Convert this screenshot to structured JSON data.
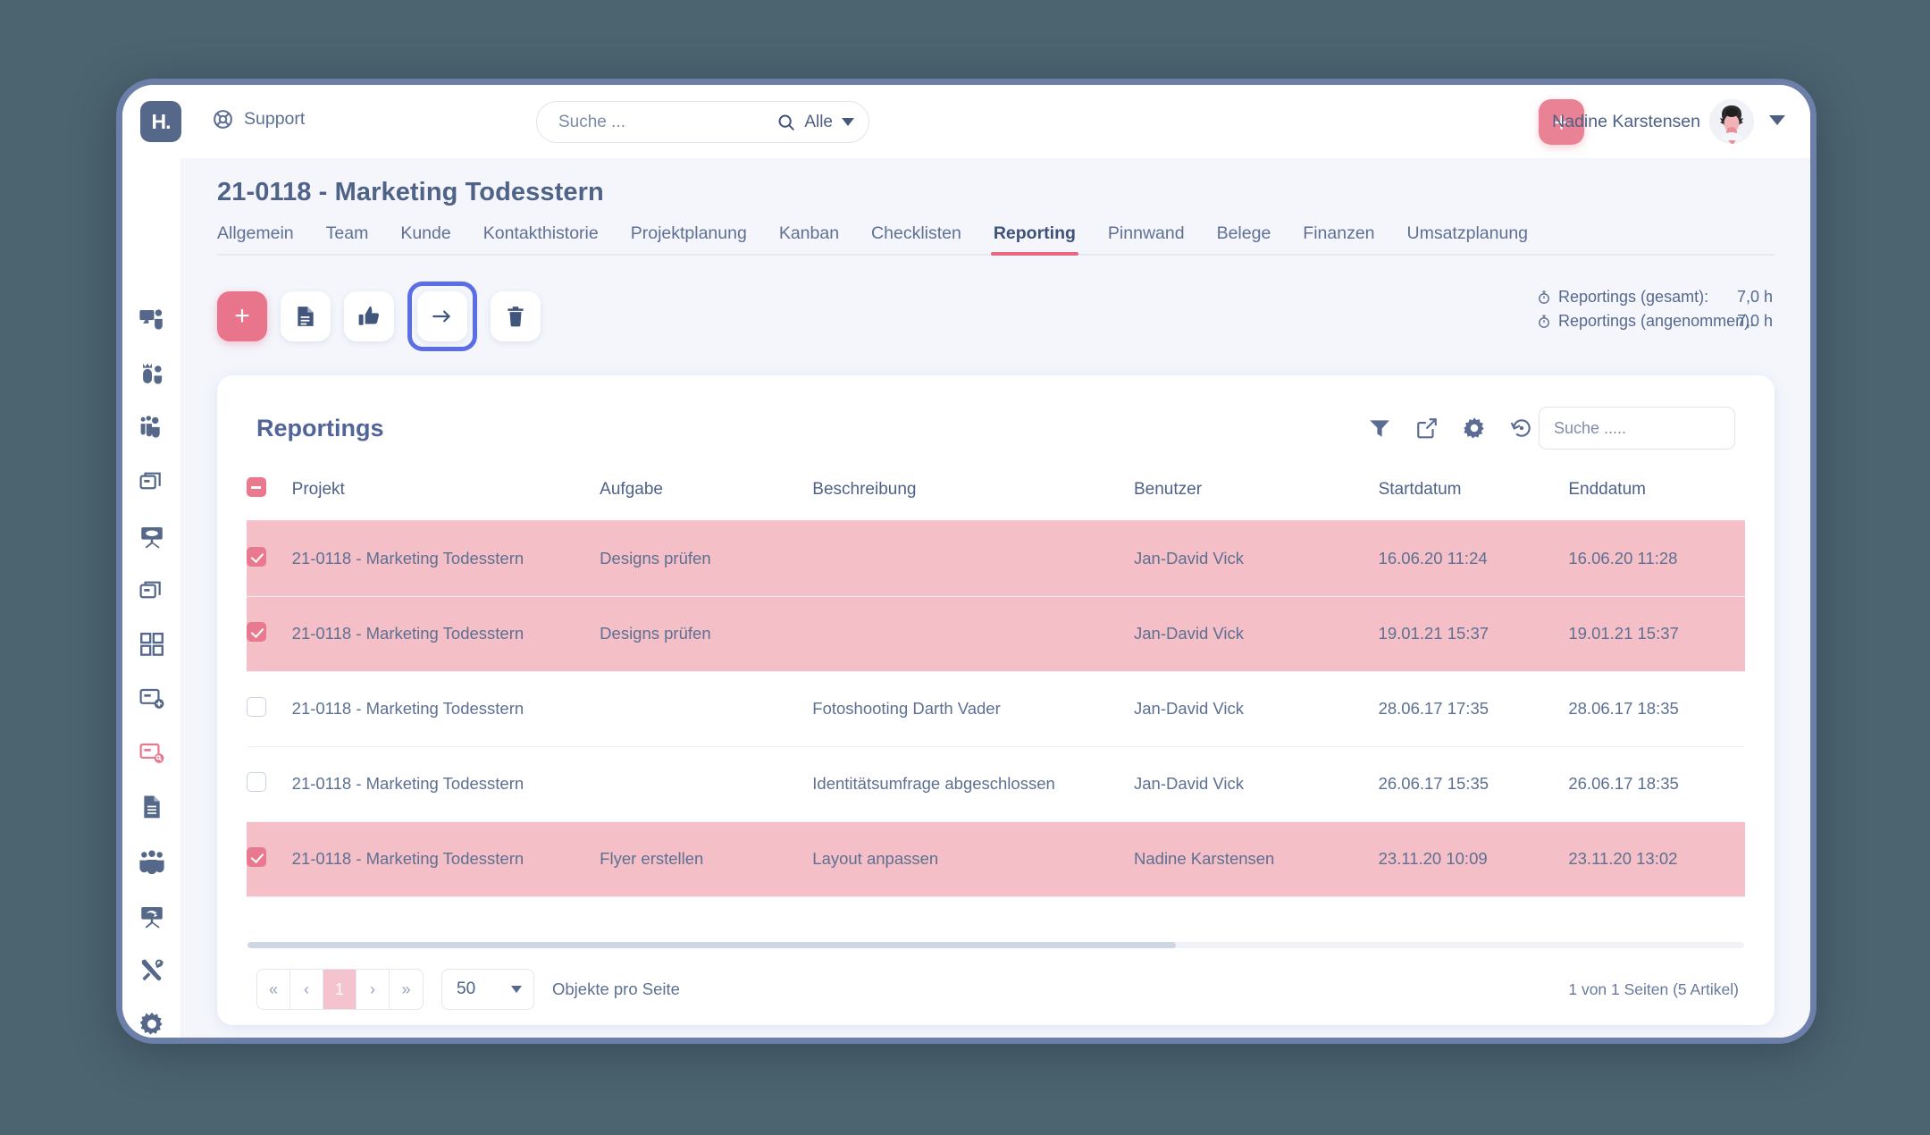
{
  "topbar": {
    "logo_glyph": "H.",
    "support_label": "Support",
    "search_placeholder": "Suche ...",
    "search_value": "",
    "scope_label": "Alle",
    "add_label": "+",
    "user_name": "Nadine Karstensen"
  },
  "sidebar": {
    "items": [
      {
        "name": "presentation-user-icon",
        "active": false
      },
      {
        "name": "user-crown-icon",
        "active": false
      },
      {
        "name": "users-group-icon",
        "active": false
      },
      {
        "name": "cards-stack-icon",
        "active": false
      },
      {
        "name": "whiteboard-icon",
        "active": false
      },
      {
        "name": "cards-stack-alt-icon",
        "active": false
      },
      {
        "name": "dashboard-grid-icon",
        "active": false
      },
      {
        "name": "card-add-icon",
        "active": false
      },
      {
        "name": "card-search-icon",
        "active": true
      },
      {
        "name": "document-icon",
        "active": false
      },
      {
        "name": "team-icon",
        "active": false
      },
      {
        "name": "whiteboard-arrow-icon",
        "active": false
      },
      {
        "name": "tools-icon",
        "active": false
      },
      {
        "name": "settings-gear-icon",
        "active": false
      }
    ]
  },
  "page": {
    "title": "21-0118 - Marketing Todesstern",
    "tabs": [
      {
        "label": "Allgemein",
        "active": false
      },
      {
        "label": "Team",
        "active": false
      },
      {
        "label": "Kunde",
        "active": false
      },
      {
        "label": "Kontakthistorie",
        "active": false
      },
      {
        "label": "Projektplanung",
        "active": false
      },
      {
        "label": "Kanban",
        "active": false
      },
      {
        "label": "Checklisten",
        "active": false
      },
      {
        "label": "Reporting",
        "active": true
      },
      {
        "label": "Pinnwand",
        "active": false
      },
      {
        "label": "Belege",
        "active": false
      },
      {
        "label": "Finanzen",
        "active": false
      },
      {
        "label": "Umsatzplanung",
        "active": false
      }
    ]
  },
  "toolbar": {
    "buttons": [
      {
        "name": "add-reporting-button",
        "icon": "plus-icon",
        "label": "+",
        "style": "primary",
        "focused": false
      },
      {
        "name": "document-button",
        "icon": "document-lines-icon",
        "label": "",
        "style": "plain",
        "focused": false
      },
      {
        "name": "approve-button",
        "icon": "thumbs-up-icon",
        "label": "",
        "style": "plain",
        "focused": false
      },
      {
        "name": "transfer-button",
        "icon": "arrow-right-icon",
        "label": "",
        "style": "plain",
        "focused": true
      },
      {
        "name": "delete-button",
        "icon": "trash-icon",
        "label": "",
        "style": "plain",
        "focused": false
      }
    ]
  },
  "stats": [
    {
      "icon": "stopwatch-icon",
      "label": "Reportings (gesamt):",
      "value": "7,0 h"
    },
    {
      "icon": "stopwatch-icon",
      "label": "Reportings (angenommen):",
      "value": "7,0 h"
    }
  ],
  "card": {
    "title": "Reportings",
    "tool_icons": [
      {
        "name": "filter-icon"
      },
      {
        "name": "external-link-icon"
      },
      {
        "name": "gear-icon"
      },
      {
        "name": "history-revert-icon"
      }
    ],
    "search_placeholder": "Suche .....",
    "search_value": ""
  },
  "table": {
    "select_all_state": "indeterminate",
    "columns": [
      "Projekt",
      "Aufgabe",
      "Beschreibung",
      "Benutzer",
      "Startdatum",
      "Enddatum"
    ],
    "rows": [
      {
        "selected": true,
        "projekt": "21-0118 - Marketing Todesstern",
        "aufgabe": "Designs prüfen",
        "beschreibung": "",
        "benutzer": "Jan-David Vick",
        "startdatum": "16.06.20 11:24",
        "enddatum": "16.06.20 11:28"
      },
      {
        "selected": true,
        "projekt": "21-0118 - Marketing Todesstern",
        "aufgabe": "Designs prüfen",
        "beschreibung": "",
        "benutzer": "Jan-David Vick",
        "startdatum": "19.01.21 15:37",
        "enddatum": "19.01.21 15:37"
      },
      {
        "selected": false,
        "projekt": "21-0118 - Marketing Todesstern",
        "aufgabe": "",
        "beschreibung": "Fotoshooting Darth Vader",
        "benutzer": "Jan-David Vick",
        "startdatum": "28.06.17 17:35",
        "enddatum": "28.06.17 18:35"
      },
      {
        "selected": false,
        "projekt": "21-0118 - Marketing Todesstern",
        "aufgabe": "",
        "beschreibung": "Identitätsumfrage abgeschlossen",
        "benutzer": "Jan-David Vick",
        "startdatum": "26.06.17 15:35",
        "enddatum": "26.06.17 18:35"
      },
      {
        "selected": true,
        "projekt": "21-0118 - Marketing Todesstern",
        "aufgabe": "Flyer erstellen",
        "beschreibung": "Layout anpassen",
        "benutzer": "Nadine Karstensen",
        "startdatum": "23.11.20 10:09",
        "enddatum": "23.11.20 13:02"
      }
    ]
  },
  "footer": {
    "pager": [
      {
        "name": "first-page-button",
        "label": "«",
        "current": false
      },
      {
        "name": "prev-page-button",
        "label": "‹",
        "current": false
      },
      {
        "name": "page-1-button",
        "label": "1",
        "current": true
      },
      {
        "name": "next-page-button",
        "label": "›",
        "current": false
      },
      {
        "name": "last-page-button",
        "label": "»",
        "current": false
      }
    ],
    "per_page_value": "50",
    "per_page_label": "Objekte pro Seite",
    "summary": "1 von 1 Seiten (5 Artikel)"
  },
  "colors": {
    "desktop_bg": "#4c6470",
    "accent_pink": "#e8758c",
    "selected_row": "#f5bfc8",
    "focus_blue": "#5b6ee6",
    "text_blue": "#4e6189"
  }
}
